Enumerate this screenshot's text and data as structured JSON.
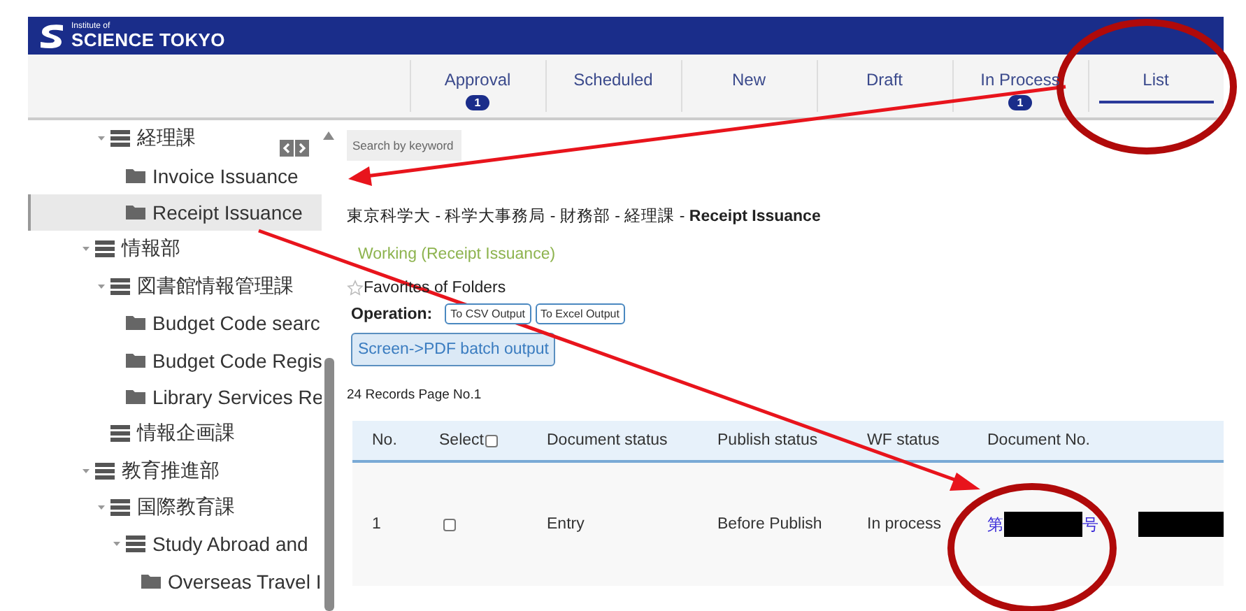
{
  "header": {
    "logo_small": "Institute of",
    "logo_name": "SCIENCE TOKYO"
  },
  "tabs": [
    {
      "label": "Approval",
      "badge": "1",
      "selected": false
    },
    {
      "label": "Scheduled",
      "selected": false
    },
    {
      "label": "New",
      "selected": false
    },
    {
      "label": "Draft",
      "selected": false
    },
    {
      "label": "In Process",
      "badge": "1",
      "selected": false
    },
    {
      "label": "List",
      "selected": true
    }
  ],
  "sidebar": {
    "tree": [
      {
        "children": [
          {
            "label": "経理課",
            "kind": "group",
            "expanded": true,
            "selected": false,
            "children": [
              {
                "label": "Invoice Issuance",
                "kind": "folder",
                "selected": false
              },
              {
                "label": "Receipt Issuance",
                "kind": "folder",
                "selected": true
              }
            ]
          }
        ]
      },
      {
        "label": "情報部",
        "kind": "group",
        "expanded": true,
        "selected": false,
        "children": [
          {
            "label": "図書館情報管理課",
            "kind": "group",
            "expanded": true,
            "selected": false,
            "children": [
              {
                "label": "Budget Code searc",
                "kind": "folder",
                "selected": false
              },
              {
                "label": "Budget Code Regis",
                "kind": "folder",
                "selected": false
              },
              {
                "label": "Library Services Re",
                "kind": "folder",
                "selected": false
              }
            ]
          },
          {
            "label": "情報企画課",
            "kind": "group",
            "selected": false
          }
        ]
      },
      {
        "label": "教育推進部",
        "kind": "group",
        "expanded": true,
        "selected": false,
        "children": [
          {
            "label": "国際教育課",
            "kind": "group",
            "expanded": true,
            "selected": false,
            "children": [
              {
                "label": "Study Abroad and",
                "kind": "group",
                "expanded": true,
                "selected": false,
                "children": [
                  {
                    "label": "Overseas Travel I",
                    "kind": "folder",
                    "selected": false
                  }
                ]
              }
            ]
          }
        ]
      }
    ]
  },
  "content": {
    "search": {
      "placeholder": "Search by keyword"
    },
    "breadcrumb": "東京科学大 - 科学大事務局 - 財務部 - 経理課 - **Receipt Issuance**",
    "working_status": "Working (Receipt Issuance)",
    "favorites": {
      "label": "Favorites of Folders",
      "starred": false
    },
    "operation": {
      "label": "Operation:",
      "buttons": [
        "To CSV Output",
        "To Excel Output"
      ]
    },
    "pdf_button": "Screen->PDF batch output",
    "records": "24 Records Page No.1",
    "table": {
      "columns": [
        "No.",
        "Select",
        "Document status",
        "Publish status",
        "WF status",
        "Document No."
      ],
      "select_all": false,
      "rows": [
        {
          "no": "1",
          "selected": false,
          "document_status": "Entry",
          "publish_status": "Before Publish",
          "wf_status": "In process",
          "document_no_start": "第",
          "document_no_redacted": true,
          "document_no_end": "号",
          "column_7_redacted": true
        }
      ]
    }
  }
}
